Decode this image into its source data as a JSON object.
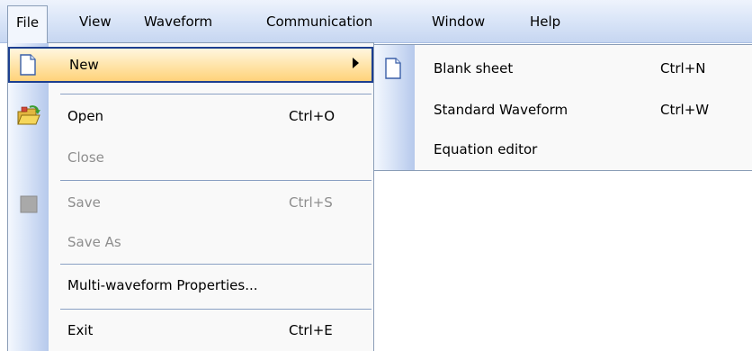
{
  "menubar": {
    "items": [
      {
        "label": "File"
      },
      {
        "label": "View"
      },
      {
        "label": "Waveform"
      },
      {
        "label": "Communication"
      },
      {
        "label": "Window"
      },
      {
        "label": "Help"
      }
    ]
  },
  "file_menu": {
    "items": [
      {
        "label": "New",
        "shortcut": "",
        "icon": "new-document-icon",
        "disabled": false,
        "highlighted": true,
        "has_submenu": true
      },
      {
        "label": "Open",
        "shortcut": "Ctrl+O",
        "icon": "open-folder-icon",
        "disabled": false
      },
      {
        "label": "Close",
        "shortcut": "",
        "disabled": true
      },
      {
        "label": "Save",
        "shortcut": "Ctrl+S",
        "icon": "save-icon",
        "disabled": true
      },
      {
        "label": "Save As",
        "shortcut": "",
        "disabled": true
      },
      {
        "label": "Multi-waveform Properties...",
        "shortcut": "",
        "disabled": false
      },
      {
        "label": "Exit",
        "shortcut": "Ctrl+E",
        "disabled": false
      }
    ]
  },
  "new_submenu": {
    "items": [
      {
        "label": "Blank sheet",
        "shortcut": "Ctrl+N",
        "icon": "blank-page-icon"
      },
      {
        "label": "Standard Waveform",
        "shortcut": "Ctrl+W"
      },
      {
        "label": "Equation editor",
        "shortcut": ""
      }
    ]
  },
  "colors": {
    "highlight_fill": "#ffe3a6",
    "highlight_border": "#1c3f90",
    "menubar_bg": "#dbe6f8",
    "disabled_text": "#8e8e8e"
  }
}
